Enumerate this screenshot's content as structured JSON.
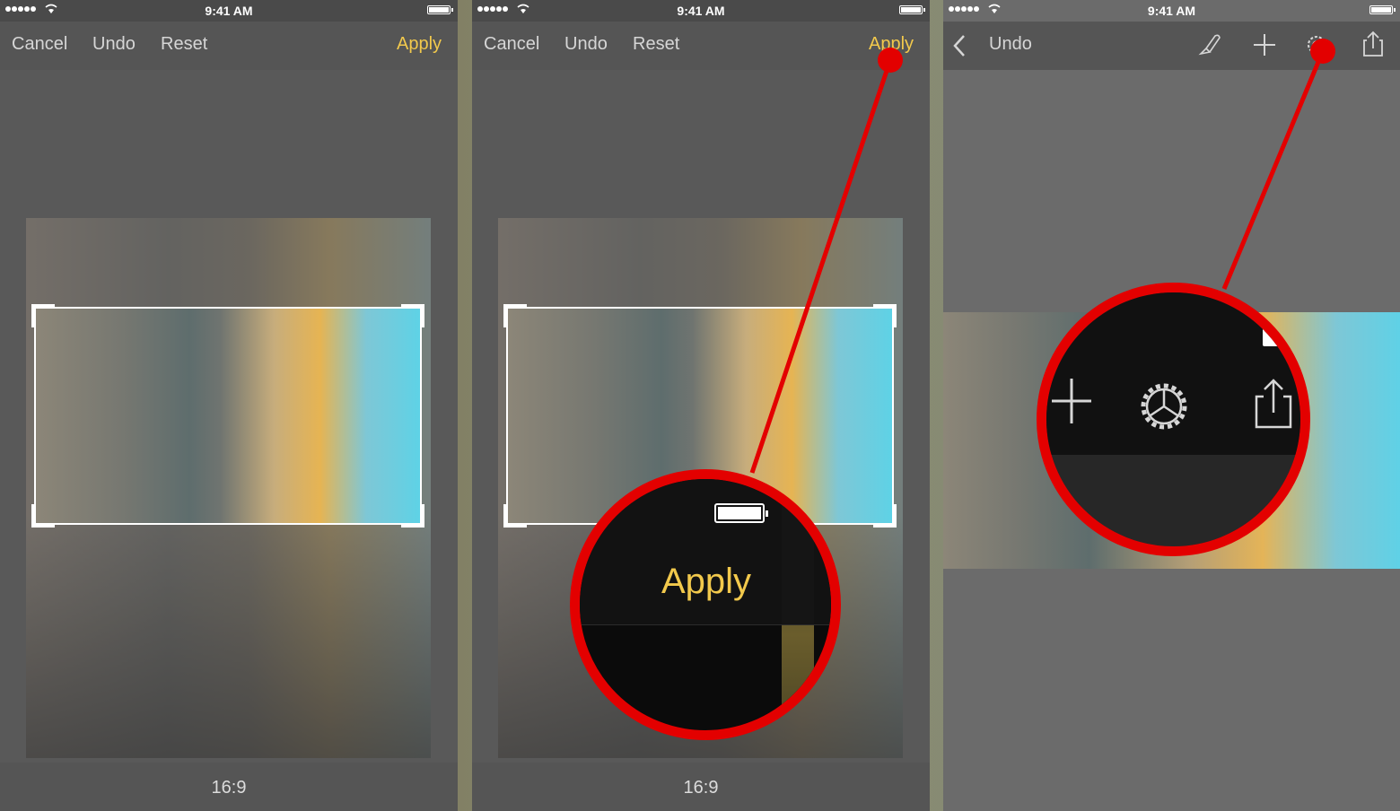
{
  "status_bar": {
    "time": "9:41 AM"
  },
  "screen1": {
    "nav": {
      "cancel": "Cancel",
      "undo": "Undo",
      "reset": "Reset",
      "apply": "Apply"
    },
    "aspect_ratio": "16:9"
  },
  "screen2": {
    "nav": {
      "cancel": "Cancel",
      "undo": "Undo",
      "reset": "Reset",
      "apply": "Apply"
    },
    "aspect_ratio": "16:9",
    "zoom_label": "Apply"
  },
  "screen3": {
    "nav": {
      "undo": "Undo"
    },
    "icons": [
      "chevron-left-icon",
      "paintbrush-icon",
      "plus-icon",
      "gear-icon",
      "share-icon"
    ]
  },
  "colors": {
    "accent_yellow": "#f2c94c",
    "callout_red": "#e30000"
  }
}
